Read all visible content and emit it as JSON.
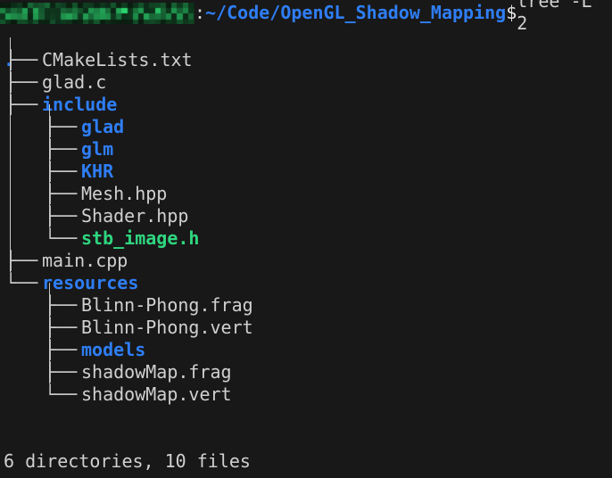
{
  "terminal": {
    "background_color": "#181818",
    "foreground_color": "#d0d0d0",
    "dir_color": "#2f7ef5",
    "exec_color": "#2fd67f",
    "branch_color": "#c6c6c6"
  },
  "prompt": {
    "user_host": "",
    "user_host_redacted": true,
    "separator": ":",
    "path": "~/Code/OpenGL_Shadow_Mapping",
    "symbol": "$",
    "command": " tree -L 2"
  },
  "tree": {
    "root": ".",
    "rows": [
      {
        "branch": "├── ",
        "label": "CMakeLists.txt",
        "kind": "file",
        "level": 1
      },
      {
        "branch": "├── ",
        "label": "glad.c",
        "kind": "file",
        "level": 1
      },
      {
        "branch": "├── ",
        "label": "include",
        "kind": "dir",
        "level": 1
      },
      {
        "branch": "├── ",
        "label": "glad",
        "kind": "dir",
        "level": 2
      },
      {
        "branch": "├── ",
        "label": "glm",
        "kind": "dir",
        "level": 2
      },
      {
        "branch": "├── ",
        "label": "KHR",
        "kind": "dir",
        "level": 2
      },
      {
        "branch": "├── ",
        "label": "Mesh.hpp",
        "kind": "file",
        "level": 2
      },
      {
        "branch": "├── ",
        "label": "Shader.hpp",
        "kind": "file",
        "level": 2
      },
      {
        "branch": "└── ",
        "label": "stb_image.h",
        "kind": "exec",
        "level": 2
      },
      {
        "branch": "├── ",
        "label": "main.cpp",
        "kind": "file",
        "level": 1
      },
      {
        "branch": "└── ",
        "label": "resources",
        "kind": "dir",
        "level": 1
      },
      {
        "branch": "├── ",
        "label": "Blinn-Phong.frag",
        "kind": "file",
        "level": 2
      },
      {
        "branch": "├── ",
        "label": "Blinn-Phong.vert",
        "kind": "file",
        "level": 2
      },
      {
        "branch": "├── ",
        "label": "models",
        "kind": "dir",
        "level": 2
      },
      {
        "branch": "├── ",
        "label": "shadowMap.frag",
        "kind": "file",
        "level": 2
      },
      {
        "branch": "└── ",
        "label": "shadowMap.vert",
        "kind": "file",
        "level": 2
      }
    ]
  },
  "summary": "6 directories, 10 files"
}
